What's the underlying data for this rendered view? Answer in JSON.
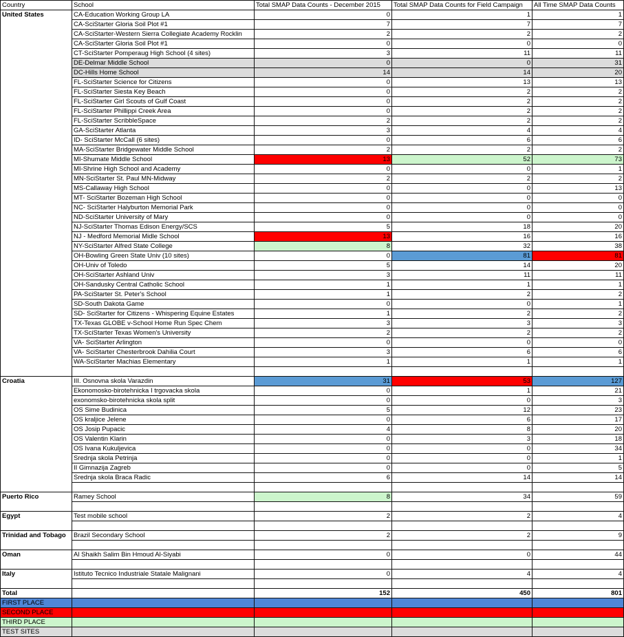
{
  "headers": [
    "Country",
    "School",
    "Total SMAP Data Counts - December 2015",
    "Total SMAP Data Counts for Field Campaign",
    "All Time SMAP Data Counts"
  ],
  "rows": [
    {
      "country": "United States",
      "school": "CA-Education Working Group LA",
      "dec": "0",
      "field": "1",
      "all": "1"
    },
    {
      "country": "",
      "school": "CA-SciStarter Gloria Soil Plot #1",
      "dec": "7",
      "field": "7",
      "all": "7"
    },
    {
      "country": "",
      "school": "CA-SciStarter-Western Sierra Collegiate Academy Rocklin",
      "dec": "2",
      "field": "2",
      "all": "2"
    },
    {
      "country": "",
      "school": "CA-SciStarter Gloria Soil Plot #1",
      "dec": "0",
      "field": "0",
      "all": "0"
    },
    {
      "country": "",
      "school": "CT-SciStarter Pomperaug High School (4 sites)",
      "dec": "3",
      "field": "11",
      "all": "11"
    },
    {
      "country": "",
      "school": "DE-Delmar Middle School",
      "dec": "0",
      "field": "0",
      "all": "31",
      "rowcls": "gray"
    },
    {
      "country": "",
      "school": "DC-Hills Home School",
      "dec": "14",
      "field": "14",
      "all": "20",
      "rowcls": "gray"
    },
    {
      "country": "",
      "school": "FL-SciStarter Science for Citizens",
      "dec": "0",
      "field": "13",
      "all": "13"
    },
    {
      "country": "",
      "school": "FL-SciStarter Siesta Key Beach",
      "dec": "0",
      "field": "2",
      "all": "2"
    },
    {
      "country": "",
      "school": "FL-SciStarter Girl Scouts of Gulf Coast",
      "dec": "0",
      "field": "2",
      "all": "2"
    },
    {
      "country": "",
      "school": "FL-SciStarter Phillippi Creek Area",
      "dec": "0",
      "field": "2",
      "all": "2"
    },
    {
      "country": "",
      "school": "FL-SciStarter ScribbleSpace",
      "dec": "2",
      "field": "2",
      "all": "2"
    },
    {
      "country": "",
      "school": "GA-SciStarter Atlanta",
      "dec": "3",
      "field": "4",
      "all": "4"
    },
    {
      "country": "",
      "school": "ID- SciStarter McCall (6 sites)",
      "dec": "0",
      "field": "6",
      "all": "6"
    },
    {
      "country": "",
      "school": "MA-SciStarter Bridgewater Middle School",
      "dec": "2",
      "field": "2",
      "all": "2"
    },
    {
      "country": "",
      "school": "MI-Shumate Middle School",
      "dec": "13",
      "field": "52",
      "all": "73",
      "deccls": "red",
      "fieldcls": "green",
      "allcls": "green"
    },
    {
      "country": "",
      "school": "MI-Shrine High School and Academy",
      "dec": "0",
      "field": "0",
      "all": "1"
    },
    {
      "country": "",
      "school": "MN-SciStarter St. Paul MN-Midway",
      "dec": "2",
      "field": "2",
      "all": "2"
    },
    {
      "country": "",
      "school": "MS-Callaway High School",
      "dec": "0",
      "field": "0",
      "all": "13"
    },
    {
      "country": "",
      "school": "MT- SciStarter Bozeman High School",
      "dec": "0",
      "field": "0",
      "all": "0"
    },
    {
      "country": "",
      "school": "NC- SciStarter Halyburton Memorial Park",
      "dec": "0",
      "field": "0",
      "all": "0"
    },
    {
      "country": "",
      "school": "ND-SciStarter University of Mary",
      "dec": "0",
      "field": "0",
      "all": "0"
    },
    {
      "country": "",
      "school": "NJ-SciStarter Thomas Edison Energy/SCS",
      "dec": "5",
      "field": "18",
      "all": "20"
    },
    {
      "country": "",
      "school": "NJ - Medford Memorial Midle School",
      "dec": "13",
      "field": "16",
      "all": "16",
      "deccls": "red"
    },
    {
      "country": "",
      "school": "NY-SciStarter Alfred State College",
      "dec": "8",
      "field": "32",
      "all": "38",
      "deccls": "green"
    },
    {
      "country": "",
      "school": "OH-Bowling Green State Univ (10 sites)",
      "dec": "0",
      "field": "81",
      "all": "81",
      "fieldcls": "blue",
      "allcls": "red"
    },
    {
      "country": "",
      "school": "OH-Univ of Toledo",
      "dec": "5",
      "field": "14",
      "all": "20"
    },
    {
      "country": "",
      "school": "OH-SciStarter Ashland Univ",
      "dec": "3",
      "field": "11",
      "all": "11"
    },
    {
      "country": "",
      "school": "OH-Sandusky Central Catholic School",
      "dec": "1",
      "field": "1",
      "all": "1"
    },
    {
      "country": "",
      "school": "PA-SciStarter St. Peter's School",
      "dec": "1",
      "field": "2",
      "all": "2"
    },
    {
      "country": "",
      "school": "SD-South Dakota Game",
      "dec": "0",
      "field": "0",
      "all": "1"
    },
    {
      "country": "",
      "school": "SD- SciStarter for Citizens - Whispering Equine Estates",
      "dec": "1",
      "field": "2",
      "all": "2"
    },
    {
      "country": "",
      "school": "TX-Texas GLOBE v-School Home Run Spec Chem",
      "dec": "3",
      "field": "3",
      "all": "3"
    },
    {
      "country": "",
      "school": "TX-SciStarter Texas Women's University",
      "dec": "2",
      "field": "2",
      "all": "2"
    },
    {
      "country": "",
      "school": "VA- SciStarter Arlington",
      "dec": "0",
      "field": "0",
      "all": "0"
    },
    {
      "country": "",
      "school": "VA- SciStarter Chesterbrook Dahilia Court",
      "dec": "3",
      "field": "6",
      "all": "6"
    },
    {
      "country": "",
      "school": "WA-SciStarter Machias Elementary",
      "dec": "1",
      "field": "1",
      "all": "1"
    },
    {
      "country": "",
      "school": "",
      "dec": "",
      "field": "",
      "all": "",
      "spacer": true
    },
    {
      "country": "Croatia",
      "school": "III. Osnovna skola Varazdin",
      "dec": "31",
      "field": "53",
      "all": "127",
      "deccls": "blue",
      "fieldcls": "red",
      "allcls": "blue"
    },
    {
      "country": "",
      "school": "Ekonomosko-birotehnicka I trgovacka skola",
      "dec": "0",
      "field": "1",
      "all": "21"
    },
    {
      "country": "",
      "school": "exonomsko-birotehnicka skola split",
      "dec": "0",
      "field": "0",
      "all": "3"
    },
    {
      "country": "",
      "school": "OS Sime Budinica",
      "dec": "5",
      "field": "12",
      "all": "23"
    },
    {
      "country": "",
      "school": "OS kraljice Jelene",
      "dec": "0",
      "field": "6",
      "all": "17"
    },
    {
      "country": "",
      "school": "OS Josip Pupacic",
      "dec": "4",
      "field": "8",
      "all": "20"
    },
    {
      "country": "",
      "school": "OS Valentin Klarin",
      "dec": "0",
      "field": "3",
      "all": "18"
    },
    {
      "country": "",
      "school": "OS Ivana Kukuljevica",
      "dec": "0",
      "field": "0",
      "all": "34"
    },
    {
      "country": "",
      "school": "Srednja skola Petrinja",
      "dec": "0",
      "field": "0",
      "all": "1"
    },
    {
      "country": "",
      "school": "II Gimnazija Zagreb",
      "dec": "0",
      "field": "0",
      "all": "5"
    },
    {
      "country": "",
      "school": "Srednja skola Braca Radic",
      "dec": "6",
      "field": "14",
      "all": "14"
    },
    {
      "country": "",
      "school": "",
      "dec": "",
      "field": "",
      "all": "",
      "spacer": true
    },
    {
      "country": "Puerto Rico",
      "school": "Ramey School",
      "dec": "8",
      "field": "34",
      "all": "59",
      "deccls": "green"
    },
    {
      "country": "",
      "school": "",
      "dec": "",
      "field": "",
      "all": "",
      "spacer": true
    },
    {
      "country": "Egypt",
      "school": "Test mobile school",
      "dec": "2",
      "field": "2",
      "all": "4"
    },
    {
      "country": "",
      "school": "",
      "dec": "",
      "field": "",
      "all": "",
      "spacer": true
    },
    {
      "country": "Trinidad and Tobago",
      "school": "Brazil Secondary School",
      "dec": "2",
      "field": "2",
      "all": "9"
    },
    {
      "country": "",
      "school": "",
      "dec": "",
      "field": "",
      "all": "",
      "spacer": true
    },
    {
      "country": "Oman",
      "school": "Al Shaikh Salim Bin Hmoud Al-Siyabi",
      "dec": "0",
      "field": "0",
      "all": "44"
    },
    {
      "country": "",
      "school": "",
      "dec": "",
      "field": "",
      "all": "",
      "spacer": true
    },
    {
      "country": "Italy",
      "school": "Istituto Tecnico Industriale Statale Malignani",
      "dec": "0",
      "field": "4",
      "all": "4"
    },
    {
      "country": "",
      "school": "",
      "dec": "",
      "field": "",
      "all": "",
      "spacer": true
    }
  ],
  "total": {
    "label": "Total",
    "dec": "152",
    "field": "450",
    "all": "801"
  },
  "legend": [
    {
      "label": "FIRST PLACE",
      "color": "#4f86d6"
    },
    {
      "label": "SECOND PLACE",
      "color": "#ff0000"
    },
    {
      "label": "THIRD PLACE",
      "color": "#ccf5cc"
    },
    {
      "label": "TEST SITES",
      "color": "#dcdcdc"
    }
  ]
}
